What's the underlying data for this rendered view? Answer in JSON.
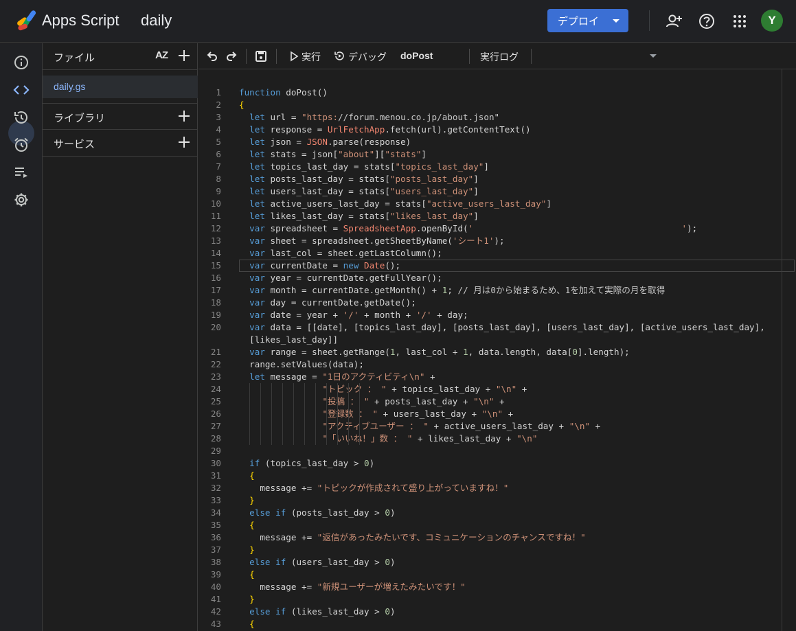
{
  "header": {
    "app_name": "Apps Script",
    "project_name": "daily",
    "deploy_label": "デプロイ",
    "avatar_initial": "Y"
  },
  "files_panel": {
    "files_label": "ファイル",
    "sort_label": "AZ",
    "file_name": "daily.gs",
    "libraries_label": "ライブラリ",
    "services_label": "サービス"
  },
  "toolbar": {
    "run_label": "実行",
    "debug_label": "デバッグ",
    "function_select": "doPost",
    "execution_log_label": "実行ログ"
  },
  "editor": {
    "line_numbers": [
      "1",
      "2",
      "3",
      "4",
      "5",
      "6",
      "7",
      "8",
      "9",
      "10",
      "11",
      "12",
      "13",
      "14",
      "15",
      "16",
      "17",
      "18",
      "19",
      "20",
      "",
      "21",
      "22",
      "23",
      "24",
      "25",
      "26",
      "27",
      "28",
      "29",
      "30",
      "31",
      "32",
      "33",
      "34",
      "35",
      "36",
      "37",
      "38",
      "39",
      "40",
      "41",
      "42",
      "43"
    ],
    "lines": [
      "function doPost()",
      "{",
      "  let url = \"https://forum.menou.co.jp/about.json\"",
      "  let response = UrlFetchApp.fetch(url).getContentText()",
      "  let json = JSON.parse(response)",
      "  let stats = json[\"about\"][\"stats\"]",
      "  let topics_last_day = stats[\"topics_last_day\"]",
      "  let posts_last_day = stats[\"posts_last_day\"]",
      "  let users_last_day = stats[\"users_last_day\"]",
      "  let active_users_last_day = stats[\"active_users_last_day\"]",
      "  let likes_last_day = stats[\"likes_last_day\"]",
      "  var spreadsheet = SpreadsheetApp.openById('                                        ');",
      "  var sheet = spreadsheet.getSheetByName('シート1');",
      "  var last_col = sheet.getLastColumn();",
      "  var currentDate = new Date();",
      "  var year = currentDate.getFullYear();",
      "  var month = currentDate.getMonth() + 1; // 月は0から始まるため、1を加えて実際の月を取得",
      "  var day = currentDate.getDate();",
      "  var date = year + '/' + month + '/' + day;",
      "  var data = [[date], [topics_last_day], [posts_last_day], [users_last_day], [active_users_last_day],",
      "  [likes_last_day]]",
      "  var range = sheet.getRange(1, last_col + 1, data.length, data[0].length);",
      "  range.setValues(data);",
      "  let message = \"1日のアクティビティ\\n\" +",
      "                \"トピック ： \" + topics_last_day + \"\\n\" +",
      "                \"投稿 ： \" + posts_last_day + \"\\n\" +",
      "                \"登録数 ： \" + users_last_day + \"\\n\" +",
      "                \"アクティブユーザー ： \" + active_users_last_day + \"\\n\" +",
      "                \"「いいね！」数 ： \" + likes_last_day + \"\\n\"",
      "",
      "  if (topics_last_day > 0)",
      "  {",
      "    message += \"トピックが作成されて盛り上がっていますね！\"",
      "  }",
      "  else if (posts_last_day > 0)",
      "  {",
      "    message += \"返信があったみたいです、コミュニケーションのチャンスですね！\"",
      "  }",
      "  else if (users_last_day > 0)",
      "  {",
      "    message += \"新規ユーザーが増えたみたいです！\"",
      "  }",
      "  else if (likes_last_day > 0)",
      "  {"
    ]
  }
}
